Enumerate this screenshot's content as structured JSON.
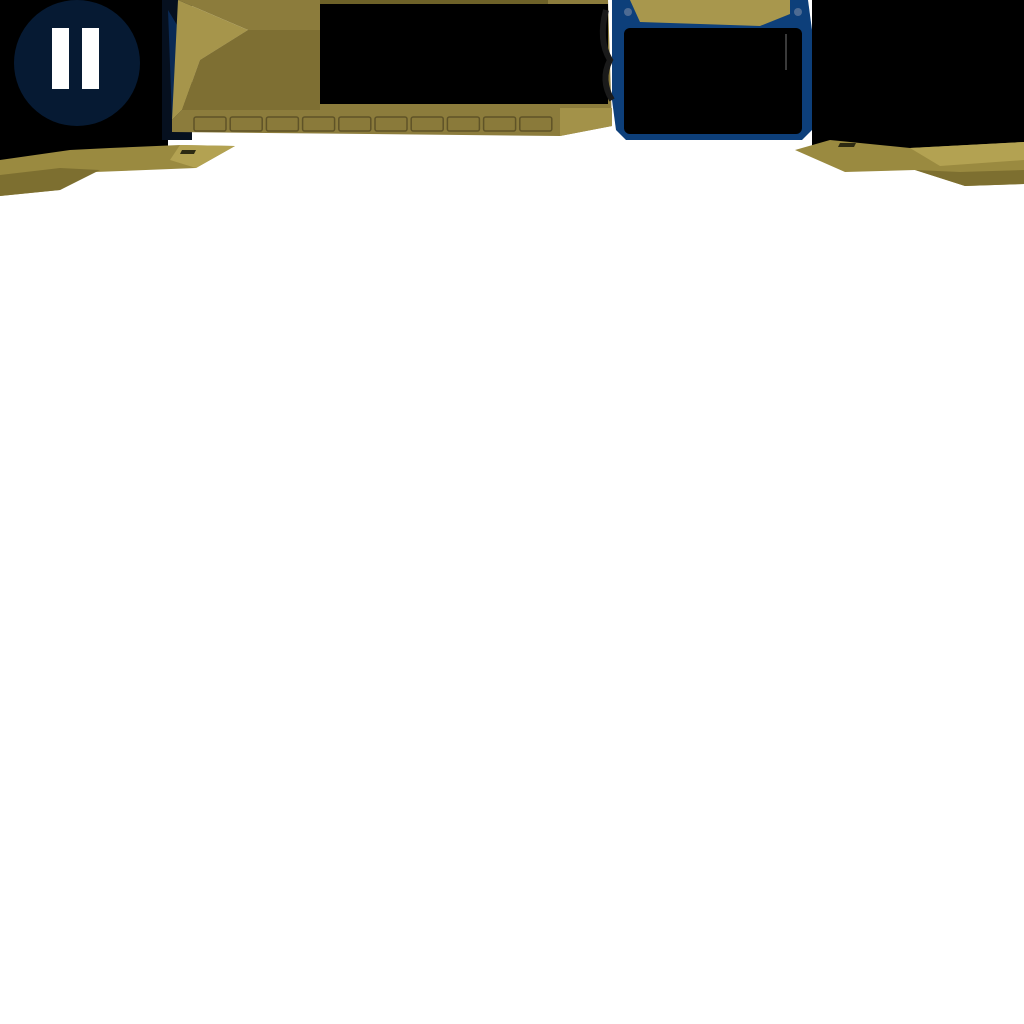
{
  "hud": {
    "pause_button": {
      "icon": "pause-icon",
      "label": ""
    },
    "inventory_slot_count": 10
  },
  "colors": {
    "metal_gold": "#8a7a3a",
    "metal_gold_light": "#a8974d",
    "metal_gold_dark": "#5f5327",
    "metal_shadow": "#3a3418",
    "panel_black": "#000000",
    "panel_blue_frame": "#0d3f7a",
    "pause_circle": "#061a33",
    "pause_bars": "#ffffff",
    "background": "#ffffff"
  }
}
